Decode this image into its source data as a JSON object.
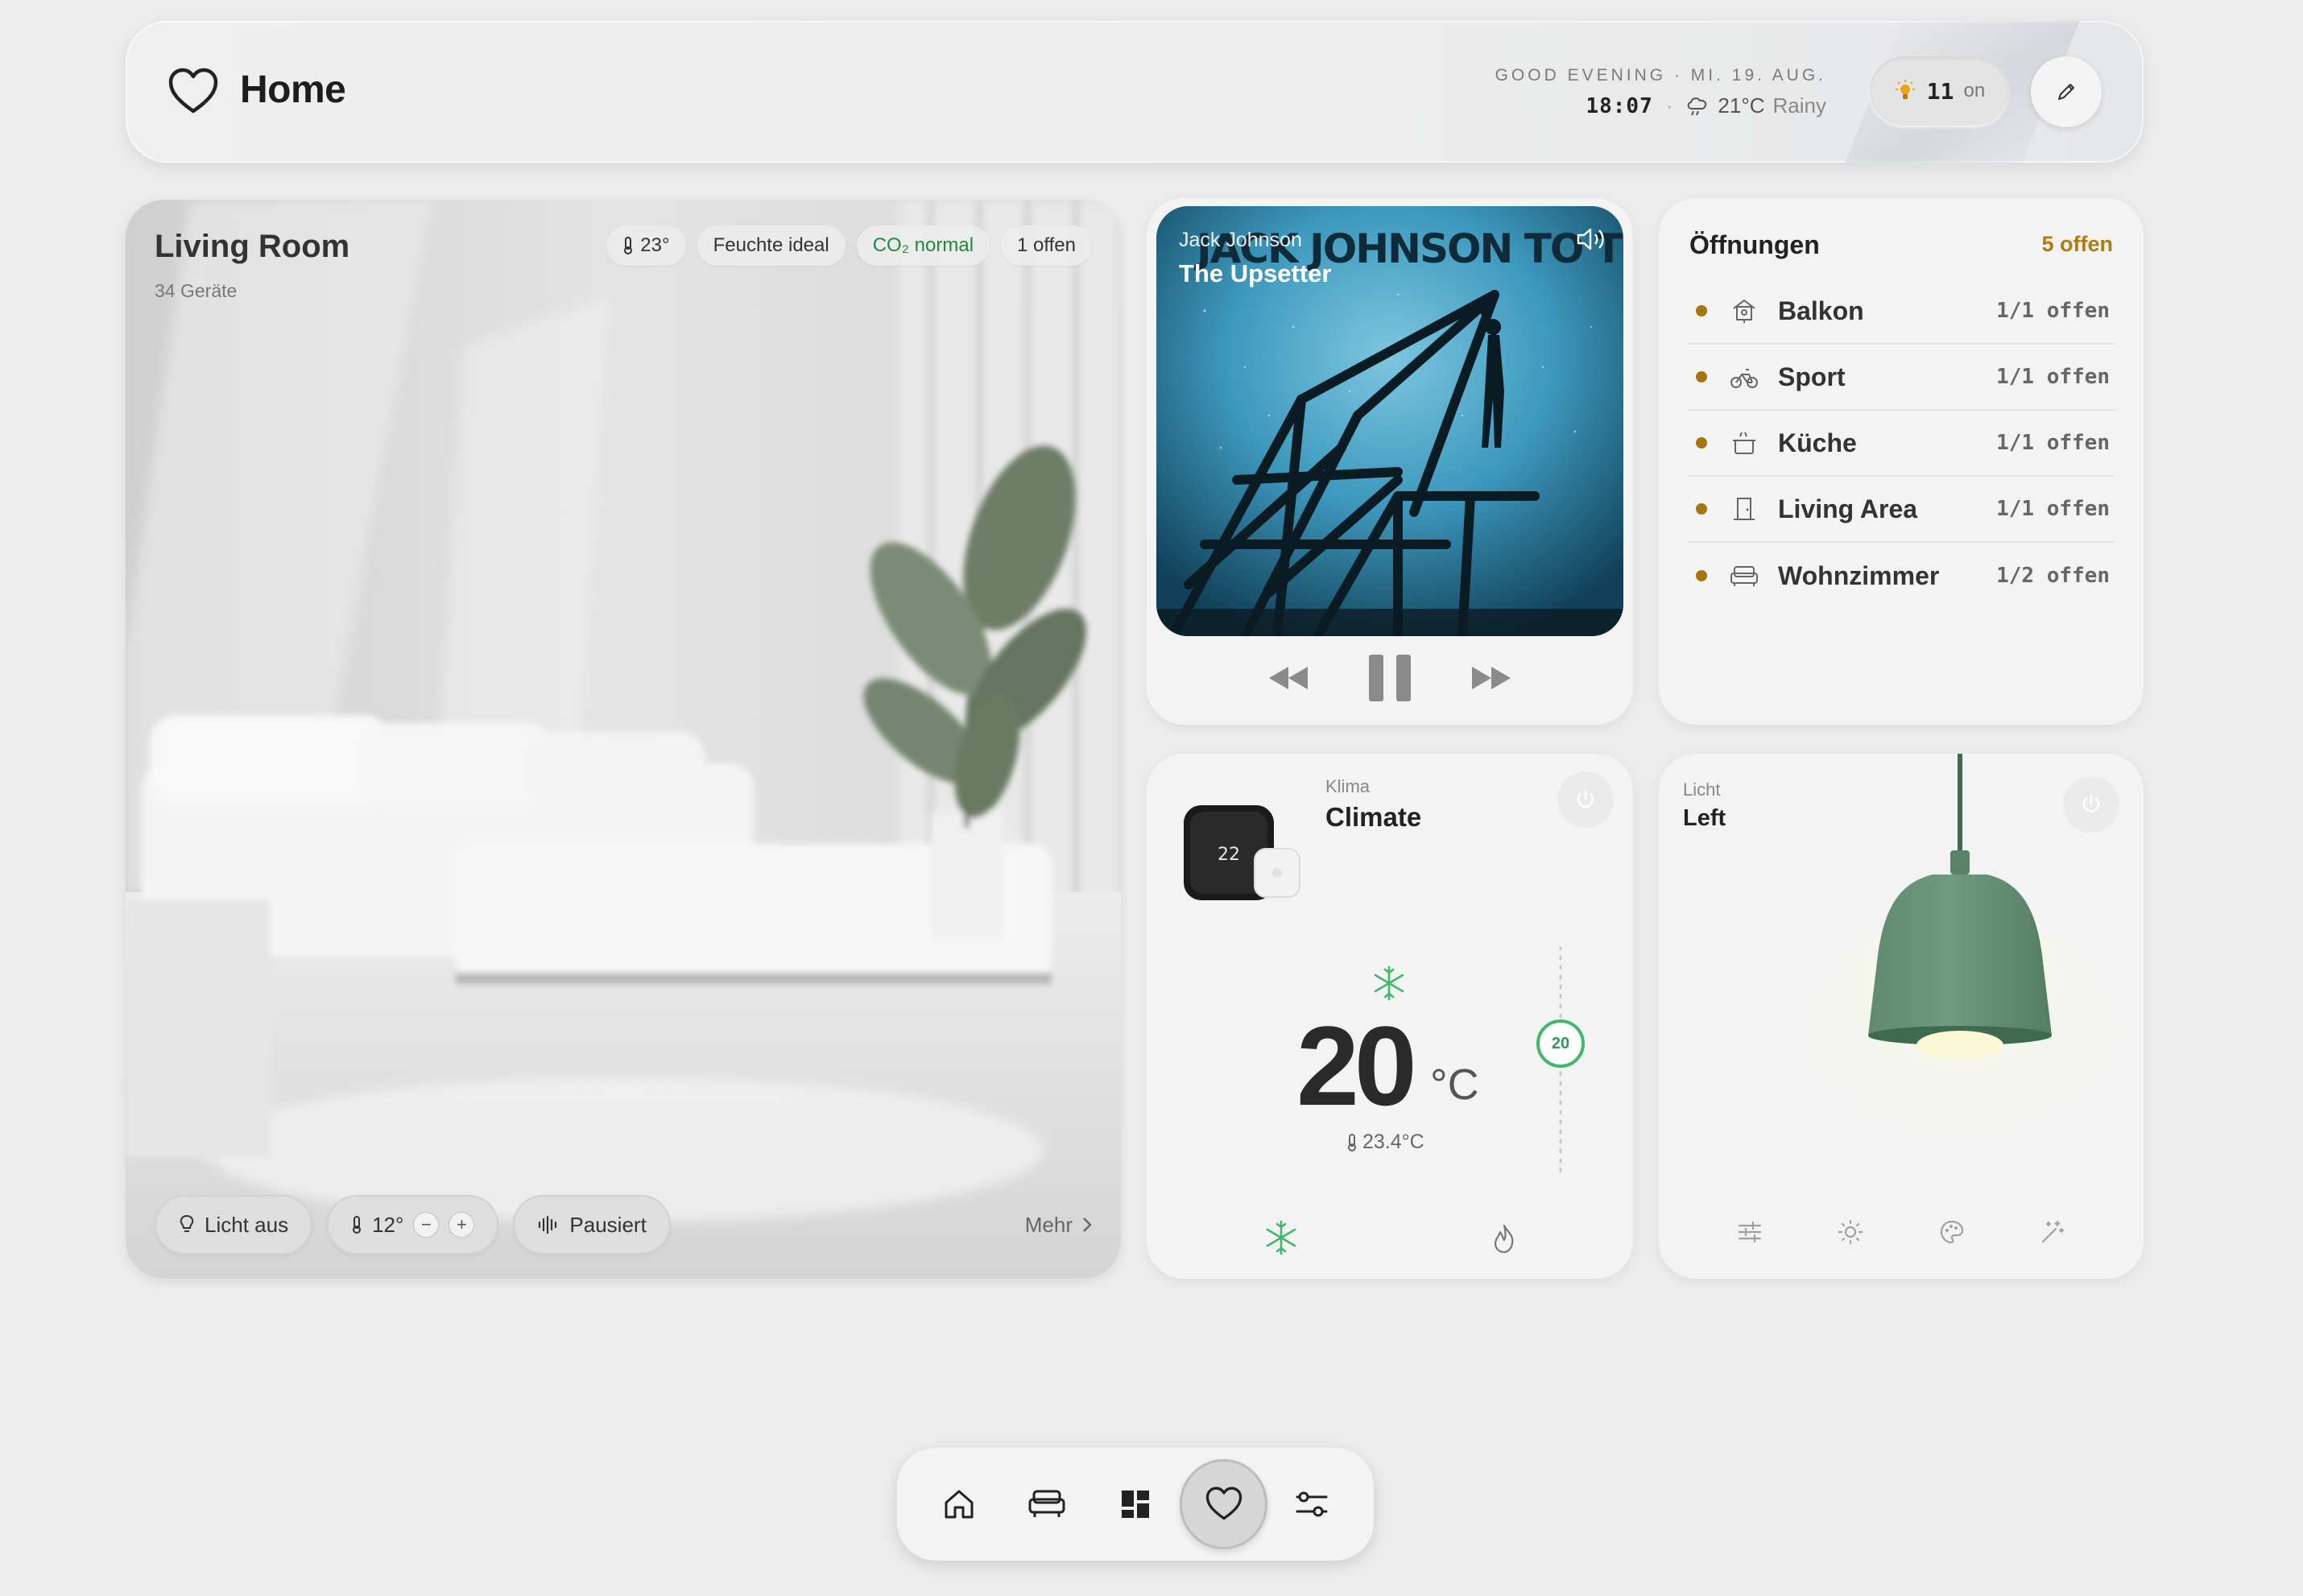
{
  "header": {
    "title": "Home",
    "greeting": "GOOD EVENING · MI. 19. AUG.",
    "time": "18:07",
    "weather": "21°C",
    "weather_desc": "Rainy",
    "lights_count": "11",
    "lights_label": "on",
    "icons": [
      "heart-icon",
      "sun-icon",
      "cloud-rain-icon",
      "pencil-icon"
    ]
  },
  "living_room": {
    "title": "Living Room",
    "device_count": "34 Geräte",
    "chips": {
      "temp": "23°",
      "humidity": "Feuchte ideal",
      "co2": "CO₂ normal",
      "open": "1 offen"
    },
    "light_button": "Licht aus",
    "thermo_value": "12°",
    "thermo_minus": "−",
    "thermo_plus": "+",
    "media_state": "Pausiert",
    "more": "Mehr"
  },
  "media": {
    "artist": "Jack Johnson",
    "track": "The Upsetter",
    "album_text": "JACK JOHNSON TO THE SEA"
  },
  "openings": {
    "title": "Öffnungen",
    "count": "5 offen",
    "rows": [
      {
        "name": "Balkon",
        "state": "1/1 offen",
        "icon": "birdhouse-icon"
      },
      {
        "name": "Sport",
        "state": "1/1 offen",
        "icon": "bicycle-icon"
      },
      {
        "name": "Küche",
        "state": "1/1 offen",
        "icon": "cooking-pot-icon"
      },
      {
        "name": "Living Area",
        "state": "1/1 offen",
        "icon": "door-icon"
      },
      {
        "name": "Wohnzimmer",
        "state": "1/2 offen",
        "icon": "sofa-icon"
      }
    ],
    "accent": "#a8740e"
  },
  "climate": {
    "label": "Klima",
    "name": "Climate",
    "device_display": "22",
    "setpoint": "20",
    "unit": "°C",
    "current": "23.4°C",
    "setpoint_knob": "20",
    "accent": "#3fb869"
  },
  "light": {
    "label": "Licht",
    "name": "Left"
  },
  "dock": {
    "items": [
      "home-icon",
      "sofa-icon",
      "dashboard-icon",
      "heart-icon",
      "sliders-icon"
    ],
    "active": "heart-icon"
  }
}
